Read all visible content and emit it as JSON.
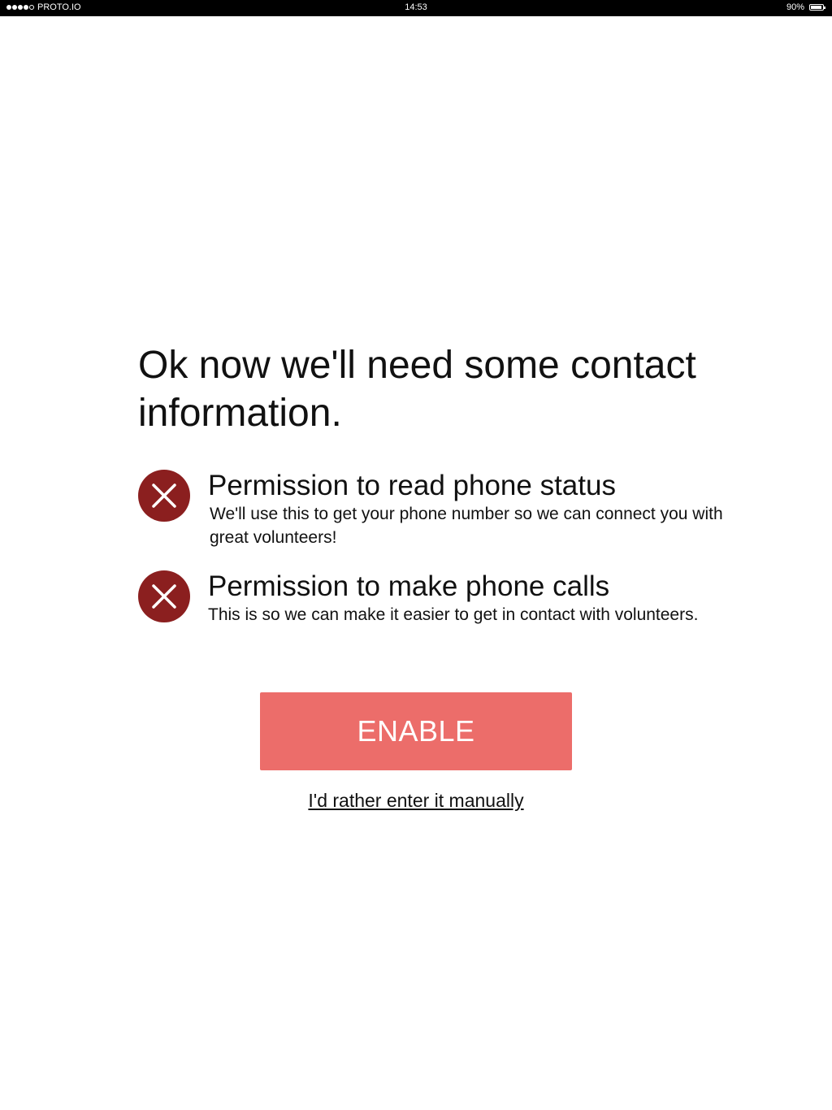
{
  "status_bar": {
    "carrier": "PROTO.IO",
    "time": "14:53",
    "battery": "90%",
    "battery_level": 0.9,
    "signal_bars_filled": 4,
    "signal_bars_total": 5
  },
  "main": {
    "title": "Ok now we'll need some contact information.",
    "permissions": [
      {
        "title": "Permission to read phone status",
        "description": "We'll use this to get your phone number so we can connect you with great volunteers!",
        "icon": "close-circle-icon",
        "granted": false
      },
      {
        "title": "Permission to make phone calls",
        "description": "This is so we can make it easier to get in contact with volunteers.",
        "icon": "close-circle-icon",
        "granted": false
      }
    ],
    "enable_label": "ENABLE",
    "manual_link": "I'd rather enter it manually"
  },
  "colors": {
    "accent": "#ec6d6a",
    "denied_icon": "#8b1f1f"
  }
}
